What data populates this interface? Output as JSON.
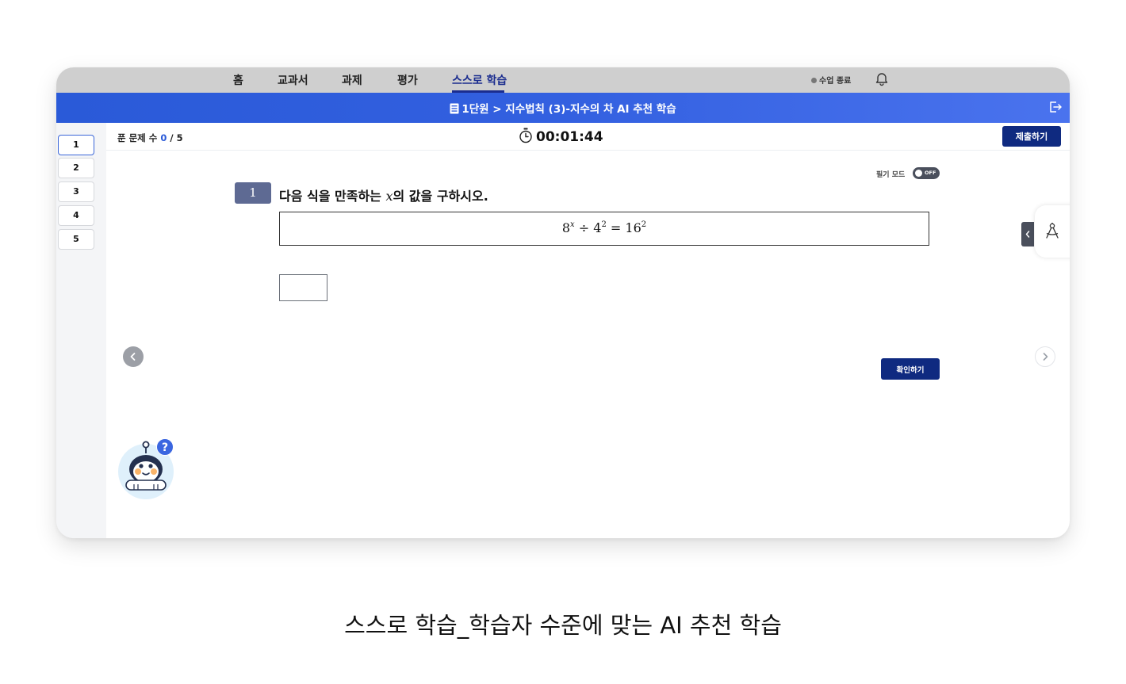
{
  "nav": {
    "items": [
      "홈",
      "교과서",
      "과제",
      "평가",
      "스스로 학습"
    ],
    "active_index": 4,
    "end_class_label": "수업 종료",
    "bell_icon": "bell-icon"
  },
  "titlebar": {
    "title": "1단원 > 지수법칙 (3)-지수의 차 AI 추천 학습",
    "doc_icon": "document-icon",
    "exit_icon": "exit-icon"
  },
  "sidebar": {
    "questions": [
      "1",
      "2",
      "3",
      "4",
      "5"
    ],
    "active_index": 0
  },
  "header": {
    "solved_label": "푼 문제 수",
    "solved_count": "0",
    "total": "/ 5",
    "timer": "00:01:44",
    "submit_label": "제출하기"
  },
  "question": {
    "pen_mode_label": "필기 모드",
    "toggle_state": "OFF",
    "number": "1",
    "text_before": "다음 식을 만족하는",
    "variable": "x",
    "text_after": "의 값을 구하시오.",
    "equation": {
      "base1": "8",
      "exp1": "x",
      "op1": "÷",
      "base2": "4",
      "exp2": "2",
      "op2": "=",
      "base3": "16",
      "exp3": "2"
    },
    "answer_value": "",
    "confirm_label": "확인하기"
  },
  "helper": {
    "badge": "?"
  },
  "caption": "스스로 학습_학습자 수준에 맞는 AI 추천 학습",
  "colors": {
    "nav_bg": "#cfcfcf",
    "titlebar": "#3360e0",
    "primary_button": "#0f2a80",
    "active_nav": "#1b2d8f",
    "question_badge": "#5e6a93"
  }
}
